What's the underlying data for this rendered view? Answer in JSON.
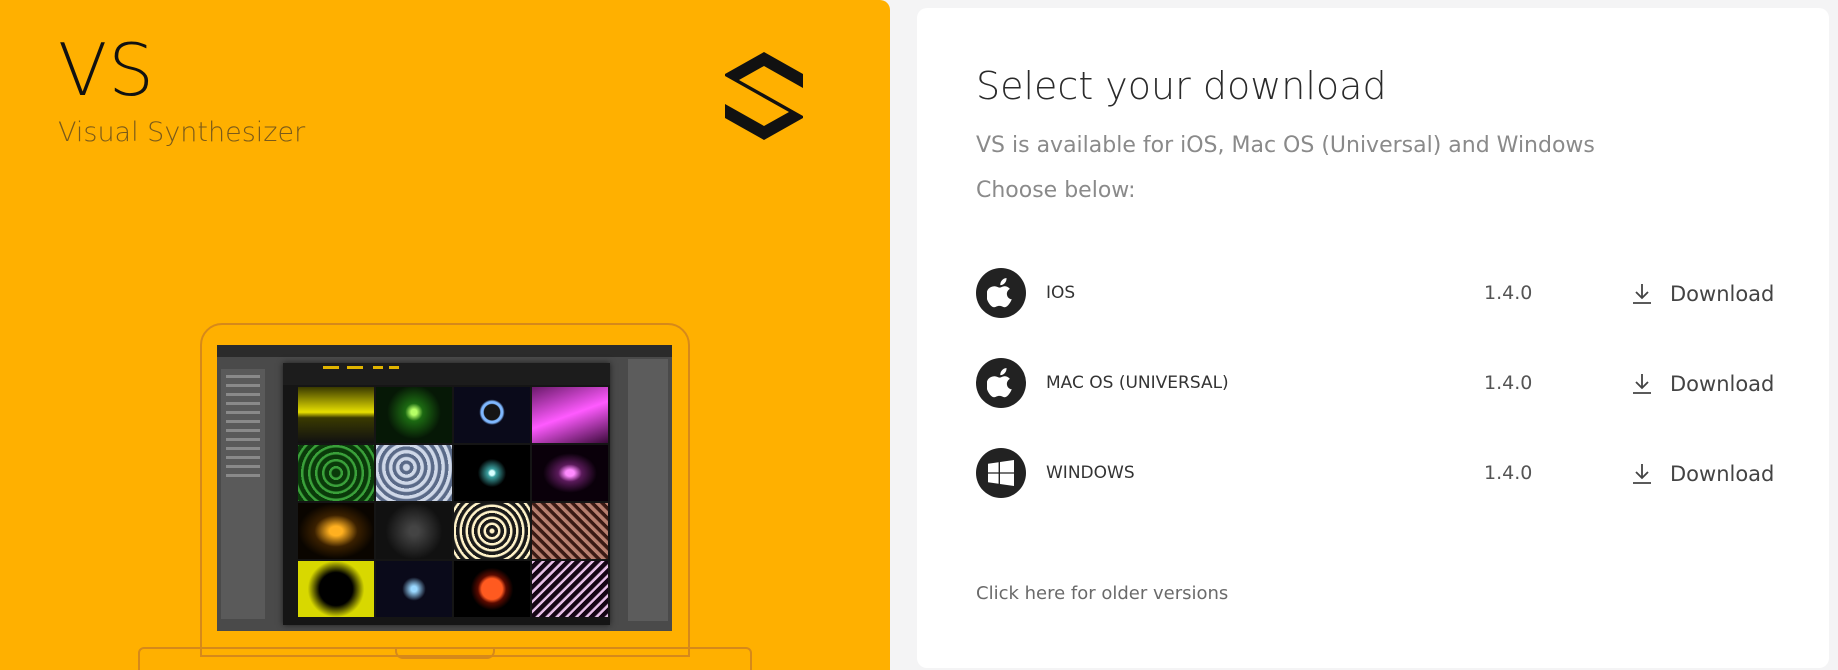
{
  "brand": {
    "title": "VS",
    "subtitle": "Visual Synthesizer"
  },
  "colors": {
    "brand_panel": "#ffb000",
    "card_bg": "#ffffff",
    "icon_circle": "#222222"
  },
  "download_card": {
    "heading": "Select your download",
    "intro": "VS is available for iOS, Mac OS (Universal) and Windows",
    "choose": "Choose below:",
    "platforms": [
      {
        "icon": "apple-icon",
        "name": "IOS",
        "version": "1.4.0",
        "action": "Download"
      },
      {
        "icon": "apple-icon",
        "name": "MAC OS (UNIVERSAL)",
        "version": "1.4.0",
        "action": "Download"
      },
      {
        "icon": "windows-icon",
        "name": "WINDOWS",
        "version": "1.4.0",
        "action": "Download"
      }
    ],
    "older_versions_link": "Click here for older versions"
  }
}
